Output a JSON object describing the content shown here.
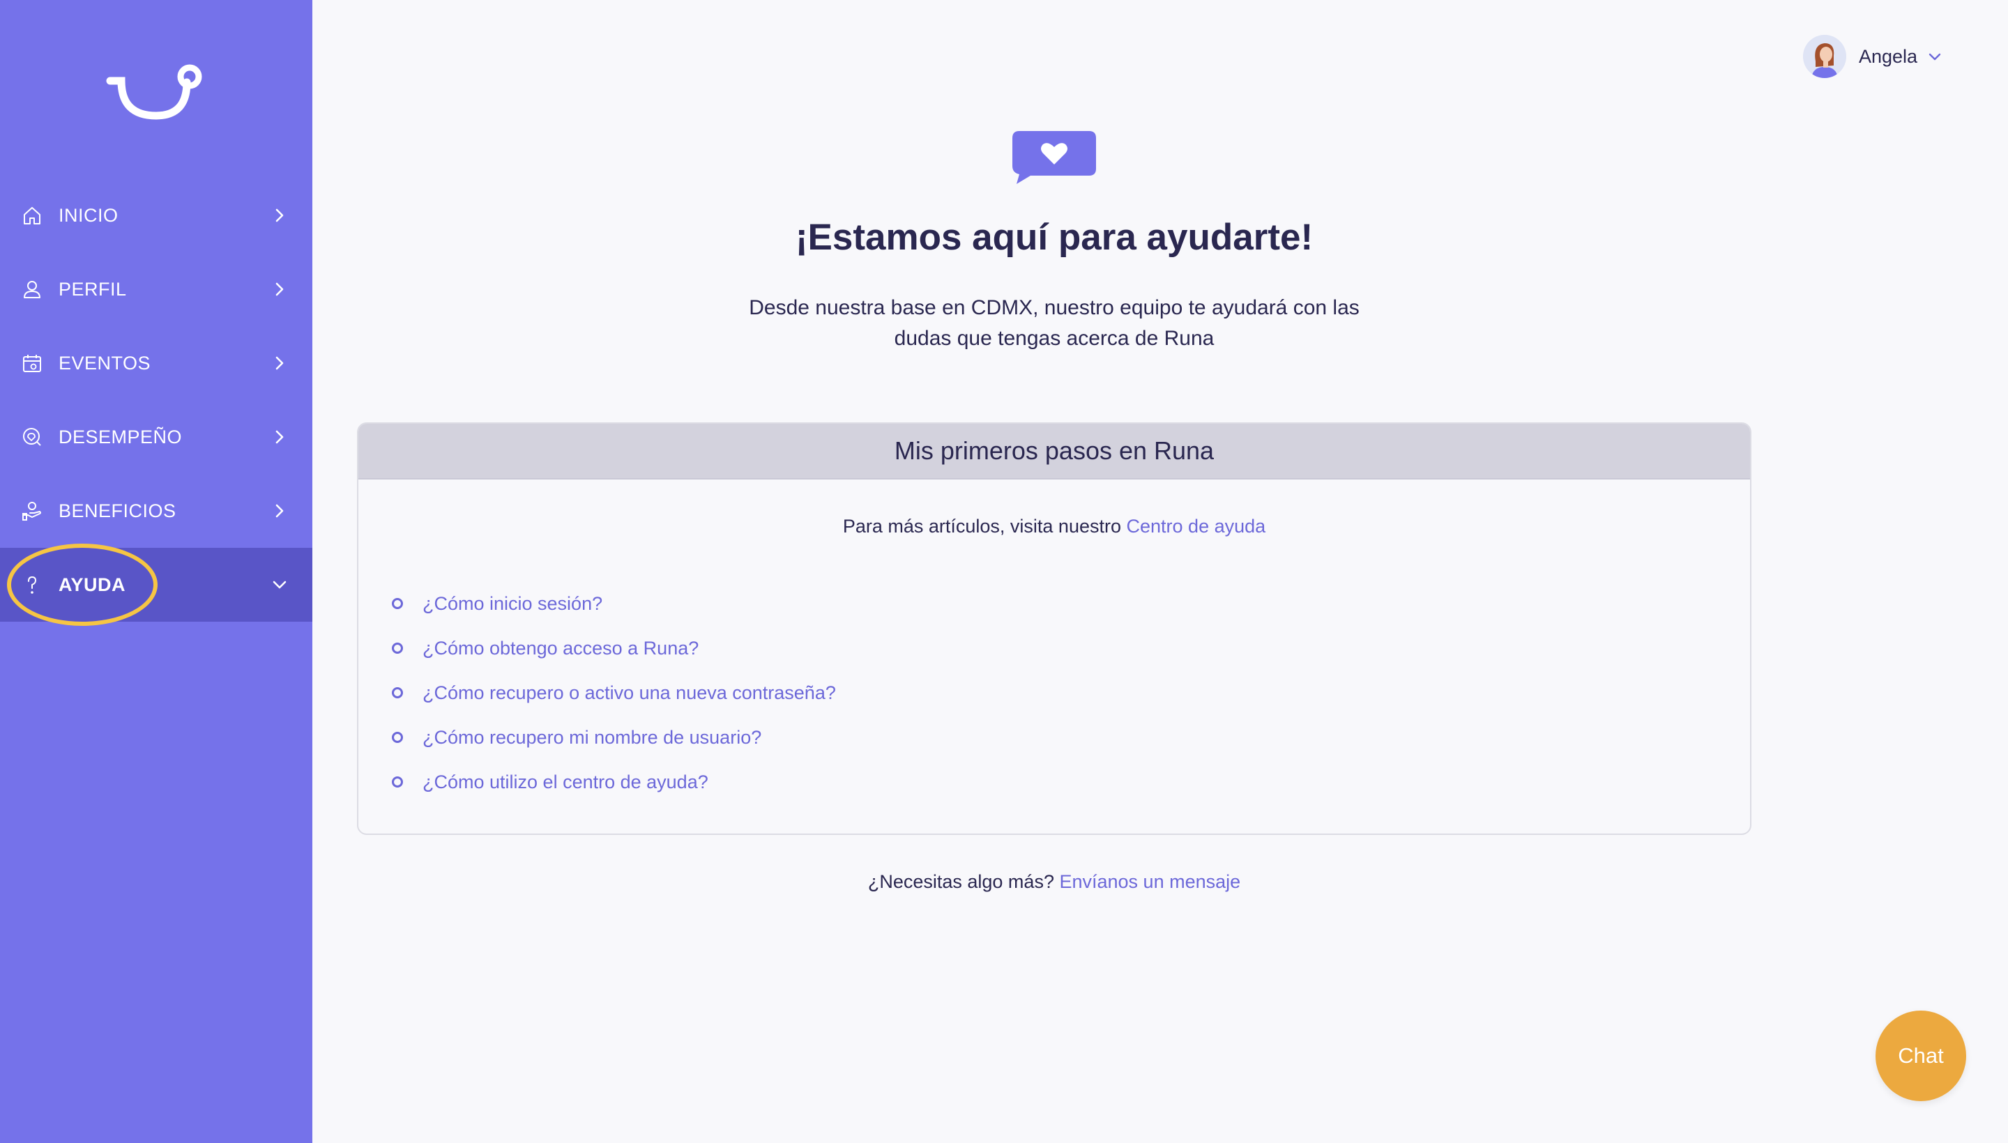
{
  "colors": {
    "sidebar_bg": "#7572ea",
    "sidebar_active_bg": "#5955c7",
    "highlight_ring": "#f6c544",
    "link": "#6c68d9",
    "chat_bg": "#eca93f",
    "text_dark": "#2a2750"
  },
  "sidebar": {
    "logo_icon": "runa-smile-logo",
    "items": [
      {
        "label": "INICIO",
        "icon": "home-icon",
        "chevron": "chevron-right"
      },
      {
        "label": "PERFIL",
        "icon": "user-icon",
        "chevron": "chevron-right"
      },
      {
        "label": "EVENTOS",
        "icon": "calendar-icon",
        "chevron": "chevron-right"
      },
      {
        "label": "DESEMPEÑO",
        "icon": "performance-icon",
        "chevron": "chevron-right"
      },
      {
        "label": "BENEFICIOS",
        "icon": "benefits-icon",
        "chevron": "chevron-right"
      },
      {
        "label": "AYUDA",
        "icon": "question-icon",
        "chevron": "chevron-down",
        "active": true
      }
    ]
  },
  "user": {
    "name": "Angela"
  },
  "hero": {
    "icon": "heart-chat-bubble-icon",
    "title": "¡Estamos aquí para ayudarte!",
    "subtitle": "Desde nuestra base en CDMX, nuestro equipo te ayudará con las dudas que tengas acerca de Runa"
  },
  "card": {
    "header": "Mis primeros pasos en Runa",
    "intro_text": "Para más artículos, visita nuestro",
    "intro_link": "Centro de ayuda",
    "faqs": [
      "¿Cómo inicio sesión?",
      "¿Cómo obtengo acceso a Runa?",
      "¿Cómo recupero o activo una nueva contraseña?",
      "¿Cómo recupero mi nombre de usuario?",
      "¿Cómo utilizo el centro de ayuda?"
    ]
  },
  "footer": {
    "text": "¿Necesitas algo más?",
    "link": "Envíanos un mensaje"
  },
  "chat": {
    "label": "Chat"
  }
}
